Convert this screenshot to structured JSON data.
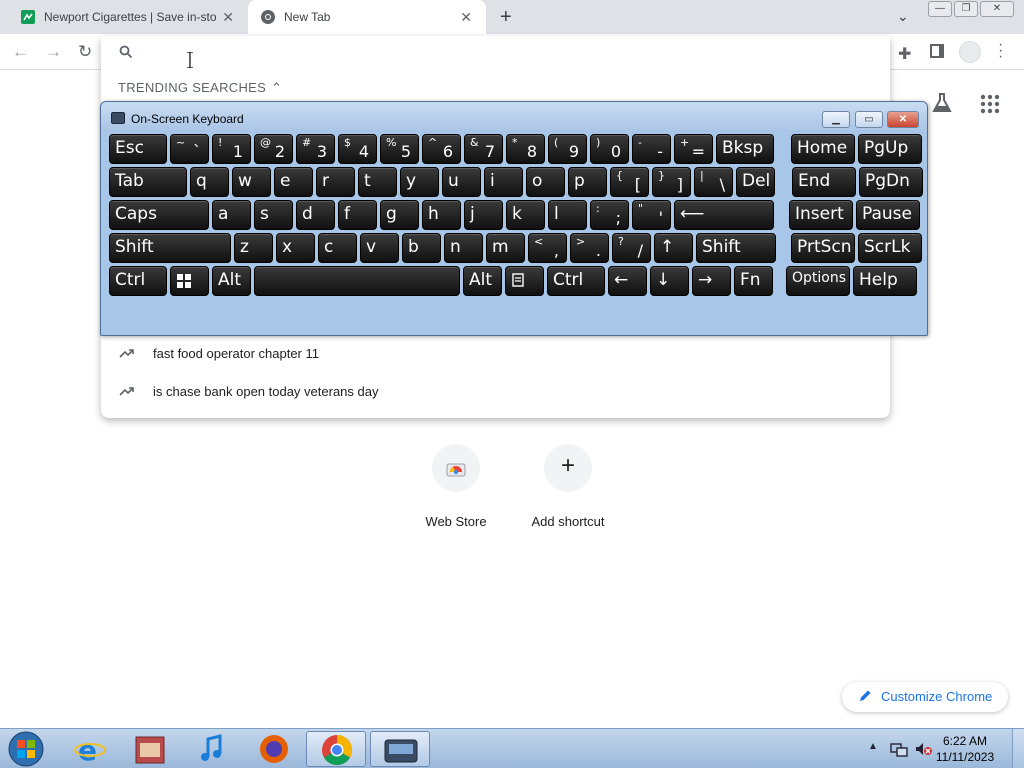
{
  "browser": {
    "tabs": [
      {
        "title": "Newport Cigarettes | Save in-sto",
        "favicon": "green-store-favicon-icon",
        "active": false
      },
      {
        "title": "New Tab",
        "favicon": "chrome-favicon-icon",
        "active": true
      }
    ],
    "new_tab_symbol": "+",
    "close_symbol": "✕"
  },
  "omnibox": {
    "input_value": "",
    "trending_label": "TRENDING SEARCHES",
    "suggestions": [
      "fast food operator chapter 11",
      "is chase bank open today veterans day"
    ]
  },
  "osk": {
    "title": "On-Screen Keyboard",
    "rows": [
      [
        {
          "main": "Esc"
        },
        {
          "shift": "~",
          "base": "`"
        },
        {
          "shift": "!",
          "base": "1"
        },
        {
          "shift": "@",
          "base": "2"
        },
        {
          "shift": "#",
          "base": "3"
        },
        {
          "shift": "$",
          "base": "4"
        },
        {
          "shift": "%",
          "base": "5"
        },
        {
          "shift": "^",
          "base": "6"
        },
        {
          "shift": "&",
          "base": "7"
        },
        {
          "shift": "*",
          "base": "8"
        },
        {
          "shift": "(",
          "base": "9"
        },
        {
          "shift": ")",
          "base": "0"
        },
        {
          "shift": "-",
          "base": "-"
        },
        {
          "shift": "+",
          "base": "="
        },
        {
          "main": "Bksp"
        },
        {
          "main": "Home"
        },
        {
          "main": "PgUp"
        }
      ],
      [
        {
          "main": "Tab"
        },
        {
          "main": "q"
        },
        {
          "main": "w"
        },
        {
          "main": "e"
        },
        {
          "main": "r"
        },
        {
          "main": "t"
        },
        {
          "main": "y"
        },
        {
          "main": "u"
        },
        {
          "main": "i"
        },
        {
          "main": "o"
        },
        {
          "main": "p"
        },
        {
          "shift": "{",
          "base": "["
        },
        {
          "shift": "}",
          "base": "]"
        },
        {
          "shift": "|",
          "base": "\\"
        },
        {
          "main": "Del"
        },
        {
          "main": "End"
        },
        {
          "main": "PgDn"
        }
      ],
      [
        {
          "main": "Caps"
        },
        {
          "main": "a"
        },
        {
          "main": "s"
        },
        {
          "main": "d"
        },
        {
          "main": "f"
        },
        {
          "main": "g"
        },
        {
          "main": "h"
        },
        {
          "main": "j"
        },
        {
          "main": "k"
        },
        {
          "main": "l"
        },
        {
          "shift": ":",
          "base": ";"
        },
        {
          "shift": "\"",
          "base": "'"
        },
        {
          "main": "⟵"
        },
        {
          "main": "Insert"
        },
        {
          "main": "Pause"
        }
      ],
      [
        {
          "main": "Shift"
        },
        {
          "main": "z"
        },
        {
          "main": "x"
        },
        {
          "main": "c"
        },
        {
          "main": "v"
        },
        {
          "main": "b"
        },
        {
          "main": "n"
        },
        {
          "main": "m"
        },
        {
          "shift": "<",
          "base": ","
        },
        {
          "shift": ">",
          "base": "."
        },
        {
          "shift": "?",
          "base": "/"
        },
        {
          "main": "↑"
        },
        {
          "main": "Shift"
        },
        {
          "main": "PrtScn"
        },
        {
          "main": "ScrLk"
        }
      ],
      [
        {
          "main": "Ctrl"
        },
        {
          "main": "windows-key-icon"
        },
        {
          "main": "Alt"
        },
        {
          "main": ""
        },
        {
          "main": "Alt"
        },
        {
          "main": "menu-key-icon"
        },
        {
          "main": "Ctrl"
        },
        {
          "main": "←"
        },
        {
          "main": "↓"
        },
        {
          "main": "→"
        },
        {
          "main": "Fn"
        },
        {
          "main": "Options"
        },
        {
          "main": "Help"
        }
      ]
    ]
  },
  "ntp": {
    "shortcuts": [
      {
        "label": "Web Store",
        "icon": "web-store-icon"
      },
      {
        "label": "Add shortcut",
        "icon": "plus-icon"
      }
    ],
    "customize_label": "Customize Chrome"
  },
  "taskbar": {
    "items": [
      "start-orb",
      "ie-icon",
      "media-center-icon",
      "itunes-icon",
      "firefox-icon",
      "chrome-icon",
      "osk-icon"
    ],
    "time": "6:22 AM",
    "date": "11/11/2023"
  }
}
